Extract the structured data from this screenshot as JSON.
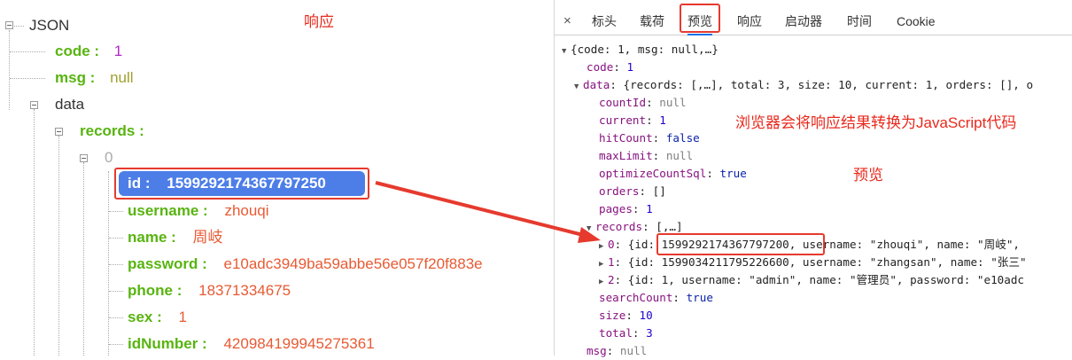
{
  "left": {
    "root": "JSON",
    "code_key": "code :",
    "code_val": "1",
    "msg_key": "msg :",
    "msg_val": "null",
    "data_key": "data",
    "records_key": "records :",
    "index0": "0",
    "id_key": "id :",
    "id_val": "1599292174367797250",
    "username_key": "username :",
    "username_val": "zhouqi",
    "name_key": "name :",
    "name_val": "周岐",
    "password_key": "password :",
    "password_val": "e10adc3949ba59abbe56e057f20f883e",
    "phone_key": "phone :",
    "phone_val": "18371334675",
    "sex_key": "sex :",
    "sex_val": "1",
    "idnumber_key": "idNumber :",
    "idnumber_val": "420984199945275361"
  },
  "annotations": {
    "response": "响应",
    "convert": "浏览器会将响应结果转换为JavaScript代码",
    "preview": "预览"
  },
  "devtools": {
    "close": "×",
    "tabs": [
      "标头",
      "载荷",
      "预览",
      "响应",
      "启动器",
      "时间",
      "Cookie"
    ],
    "active_tab": "预览",
    "line0": "{code: 1, msg: null,…}",
    "code_k": "code",
    "code_v": "1",
    "data_k": "data",
    "data_summary": "{records: [,…], total: 3, size: 10, current: 1, orders: [], o",
    "countId_k": "countId",
    "countId_v": "null",
    "current_k": "current",
    "current_v": "1",
    "hitCount_k": "hitCount",
    "hitCount_v": "false",
    "maxLimit_k": "maxLimit",
    "maxLimit_v": "null",
    "optimize_k": "optimizeCountSql",
    "optimize_v": "true",
    "orders_k": "orders",
    "orders_v": "[]",
    "pages_k": "pages",
    "pages_v": "1",
    "records_k": "records",
    "records_v": "[,…]",
    "rec0_idx": "0",
    "rec0_id": "{id: 1599292174367797200,",
    "rec0_rest": " username: \"zhouqi\", name: \"周岐\",",
    "rec1_idx": "1",
    "rec1_text": "{id: 1599034211795226600, username: \"zhangsan\", name: \"张三\"",
    "rec2_idx": "2",
    "rec2_text": "{id: 1, username: \"admin\", name: \"管理员\", password: \"e10adc",
    "search_k": "searchCount",
    "search_v": "true",
    "size_k": "size",
    "size_v": "10",
    "total_k": "total",
    "total_v": "3",
    "msg_k": "msg",
    "msg_v": "null"
  },
  "colors": {
    "key_green": "#58b410",
    "string_orange": "#e85a33",
    "number_purple": "#b327c9",
    "highlight_blue": "#4d7ee8",
    "annotation_red": "#e8291c"
  }
}
